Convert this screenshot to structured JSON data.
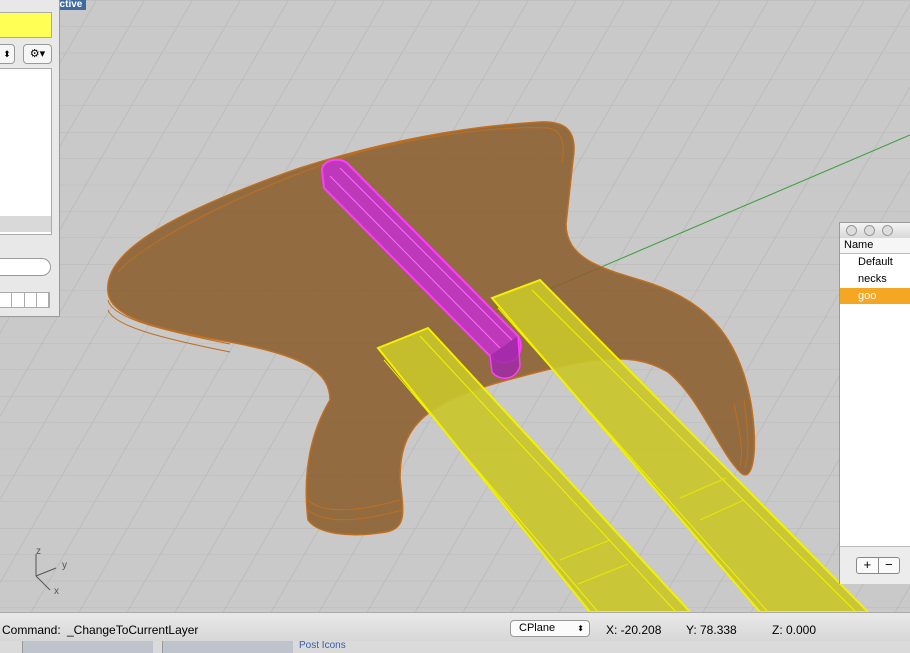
{
  "viewport": {
    "label": "ective",
    "colors": {
      "background": "#c9c9c9",
      "grid": "#b7b7b7",
      "body_fill": "#8a5e2c",
      "body_edge": "#c06e20",
      "pickup_fill": "#c234c8",
      "pickup_edge": "#ff3cff",
      "neck_fill": "#c9c62a",
      "neck_edge": "#f2f200",
      "axis_green": "#3aa03a"
    },
    "axis": {
      "z": "z",
      "y": "y",
      "x": "x"
    }
  },
  "left_panel": {
    "swatch_color": "#ffff55",
    "stepper_icon": "stepper-arrows-icon",
    "gear_icon": "gear-icon"
  },
  "layers_panel": {
    "column_header": "Name",
    "layers": [
      {
        "name": "Default",
        "selected": false
      },
      {
        "name": "necks",
        "selected": false
      },
      {
        "name": "goo",
        "selected": true
      }
    ],
    "add_label": "+",
    "remove_label": "−",
    "selected_color": "#f5a623"
  },
  "status_bar": {
    "command_label": "Command:",
    "command_value": "_ChangeToCurrentLayer",
    "cplane": "CPlane",
    "x": "X: -20.208",
    "y": "Y: 78.338",
    "z": "Z: 0.000"
  },
  "bottom_strip": {
    "text": "Post Icons"
  }
}
